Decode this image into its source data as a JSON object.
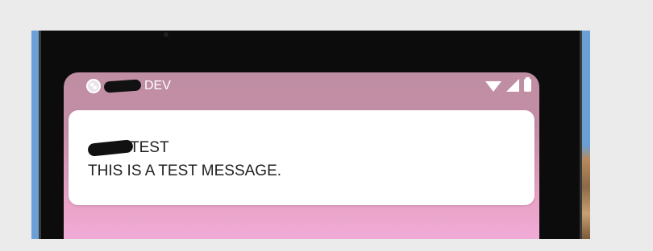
{
  "status_bar": {
    "app_label": "DEV",
    "icons": [
      "app-icon",
      "wifi-icon",
      "signal-icon",
      "battery-icon"
    ]
  },
  "notification": {
    "title": "TEST",
    "message": "THIS IS A TEST MESSAGE."
  },
  "colors": {
    "page_background": "#ebebeb",
    "screen_gradient_top": "#bf8ea2",
    "screen_gradient_bottom": "#f2addc",
    "card_background": "#ffffff",
    "text_primary": "#202020",
    "status_text": "#ffffff"
  }
}
